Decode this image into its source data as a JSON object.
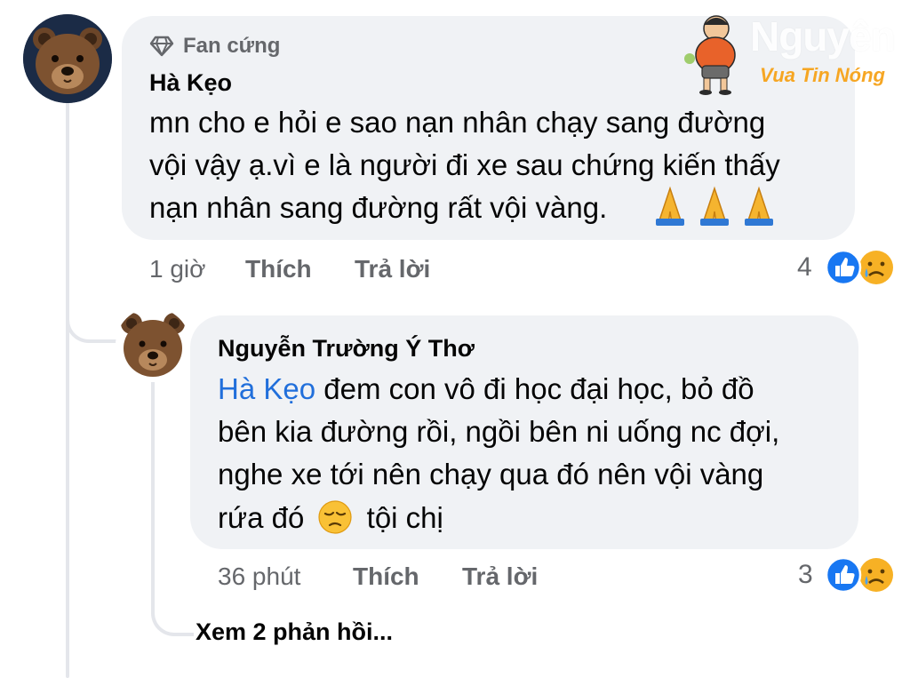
{
  "watermark": {
    "name": "Nguyên",
    "tagline": "Vua Tin Nóng"
  },
  "comment": {
    "badge": "Fan cứng",
    "author": "Hà Kẹo",
    "lines": [
      "mn cho e hỏi e sao nạn nhân chạy sang đường",
      "vội vậy ạ.vì e là người đi xe sau chứng kiến thấy",
      "nạn nhân sang đường rất vội vàng."
    ],
    "time": "1 giờ",
    "like_label": "Thích",
    "reply_label": "Trả lời",
    "reaction_count": "4"
  },
  "reply": {
    "author": "Nguyễn Trường Ý Thơ",
    "mention": "Hà Kẹo",
    "lines": [
      " đem con vô đi học đại học, bỏ đồ",
      "bên kia đường rồi, ngồi bên ni uống nc đợi,",
      "nghe xe tới nên chạy qua đó nên vội vàng",
      "rứa đó",
      "tội chị"
    ],
    "time": "36 phút",
    "like_label": "Thích",
    "reply_label": "Trả lời",
    "reaction_count": "3"
  },
  "more_replies": "Xem 2 phản hồi...",
  "icons": {
    "badge": "diamond-icon",
    "pray": "folded-hands-emoji",
    "pensive": "pensive-face-emoji",
    "like": "like-reaction-icon",
    "sad": "sad-reaction-icon"
  },
  "colors": {
    "bubble": "#f0f2f5",
    "mention": "#216fdb",
    "like_blue": "#1877f2",
    "sad_yellow": "#f7b125",
    "secondary_text": "#65676b"
  }
}
